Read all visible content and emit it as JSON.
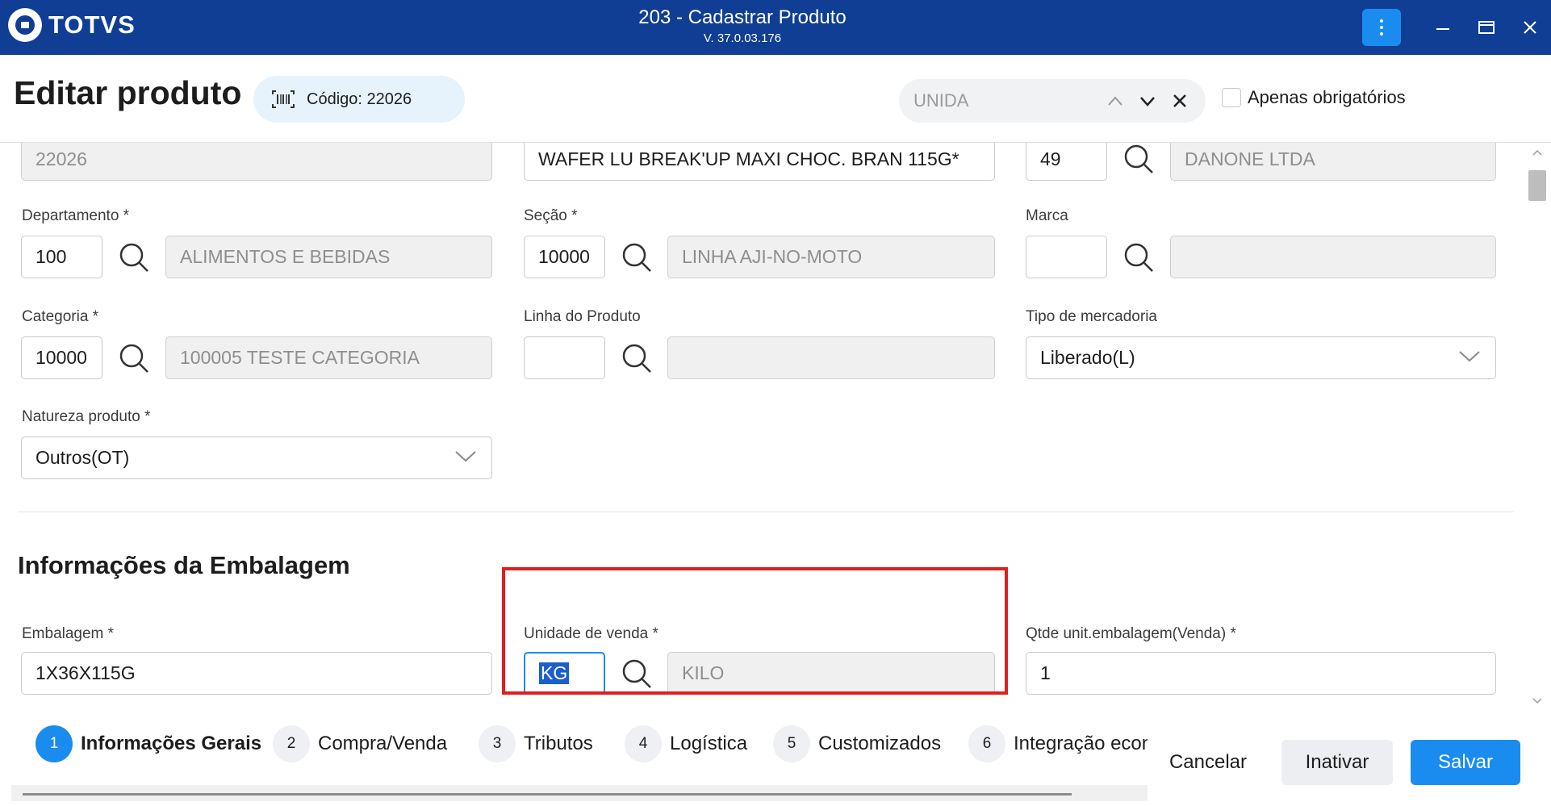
{
  "window": {
    "brand": "TOTVS",
    "title": "203 - Cadastrar Produto",
    "version": "V. 37.0.03.176"
  },
  "header": {
    "page_title": "Editar produto",
    "code_label": "Código: 22026",
    "search_value": "UNIDA",
    "only_required_label": "Apenas obrigatórios"
  },
  "form": {
    "top_row": {
      "code": "22026",
      "description": "WAFER LU BREAK'UP MAXI CHOC. BRAN 115G*",
      "supplier_code": "49",
      "supplier_name": "DANONE LTDA"
    },
    "departamento": {
      "label": "Departamento *",
      "code": "100",
      "name": "ALIMENTOS E BEBIDAS"
    },
    "secao": {
      "label": "Seção *",
      "code": "10000",
      "name": "LINHA AJI-NO-MOTO"
    },
    "marca": {
      "label": "Marca",
      "code": "",
      "name": ""
    },
    "categoria": {
      "label": "Categoria *",
      "code": "10000",
      "name": "100005 TESTE CATEGORIA"
    },
    "linha_produto": {
      "label": "Linha do Produto",
      "code": "",
      "name": ""
    },
    "tipo_mercadoria": {
      "label": "Tipo de mercadoria",
      "value": "Liberado(L)"
    },
    "natureza_produto": {
      "label": "Natureza produto *",
      "value": "Outros(OT)"
    },
    "section_embalagem": "Informações da Embalagem",
    "embalagem": {
      "label": "Embalagem *",
      "value": "1X36X115G"
    },
    "unidade_venda": {
      "label": "Unidade de venda *",
      "code": "KG",
      "name": "KILO"
    },
    "qtde_unit": {
      "label": "Qtde unit.embalagem(Venda) *",
      "value": "1"
    }
  },
  "steps": [
    {
      "num": "1",
      "label": "Informações Gerais"
    },
    {
      "num": "2",
      "label": "Compra/Venda"
    },
    {
      "num": "3",
      "label": "Tributos"
    },
    {
      "num": "4",
      "label": "Logística"
    },
    {
      "num": "5",
      "label": "Customizados"
    },
    {
      "num": "6",
      "label": "Integração econ"
    }
  ],
  "actions": {
    "cancel": "Cancelar",
    "inactivate": "Inativar",
    "save": "Salvar"
  },
  "colors": {
    "titlebar": "#0f3e94",
    "accent": "#1a8cf0",
    "highlight_box": "#e11e1e"
  }
}
